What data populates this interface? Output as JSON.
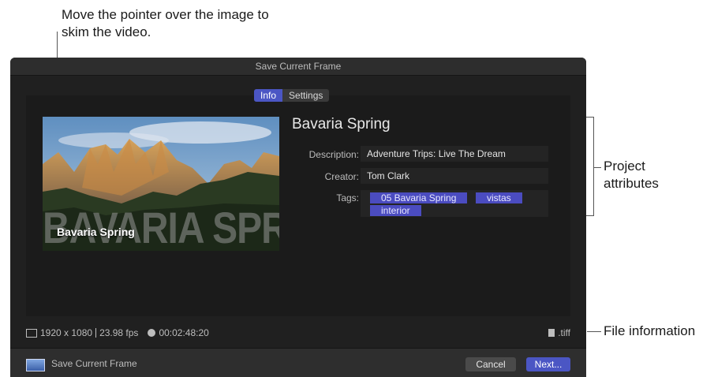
{
  "annotations": {
    "pointer_note": "Move the pointer over the image to skim the video.",
    "project_attributes": "Project\nattributes",
    "file_information": "File information"
  },
  "dialog": {
    "title": "Save Current Frame",
    "tabs": [
      {
        "label": "Info",
        "active": true
      },
      {
        "label": "Settings",
        "active": false
      }
    ],
    "preview": {
      "overlay_large": "BAVARIA SPRING",
      "overlay_small": "Bavaria Spring"
    },
    "project_title": "Bavaria Spring",
    "fields": {
      "description_label": "Description:",
      "description_value": "Adventure Trips: Live The Dream",
      "creator_label": "Creator:",
      "creator_value": "Tom Clark",
      "tags_label": "Tags:",
      "tags": [
        "05 Bavaria Spring",
        "vistas",
        "interior"
      ]
    },
    "info": {
      "resolution": "1920 x 1080",
      "fps": "23.98 fps",
      "duration": "00:02:48:20",
      "file_ext": ".tiff"
    },
    "footer": {
      "label": "Save Current Frame",
      "cancel": "Cancel",
      "next": "Next..."
    }
  },
  "colors": {
    "accent": "#4b56c4",
    "dialog_bg": "#202020",
    "tag_bg": "#4b4cc0"
  }
}
